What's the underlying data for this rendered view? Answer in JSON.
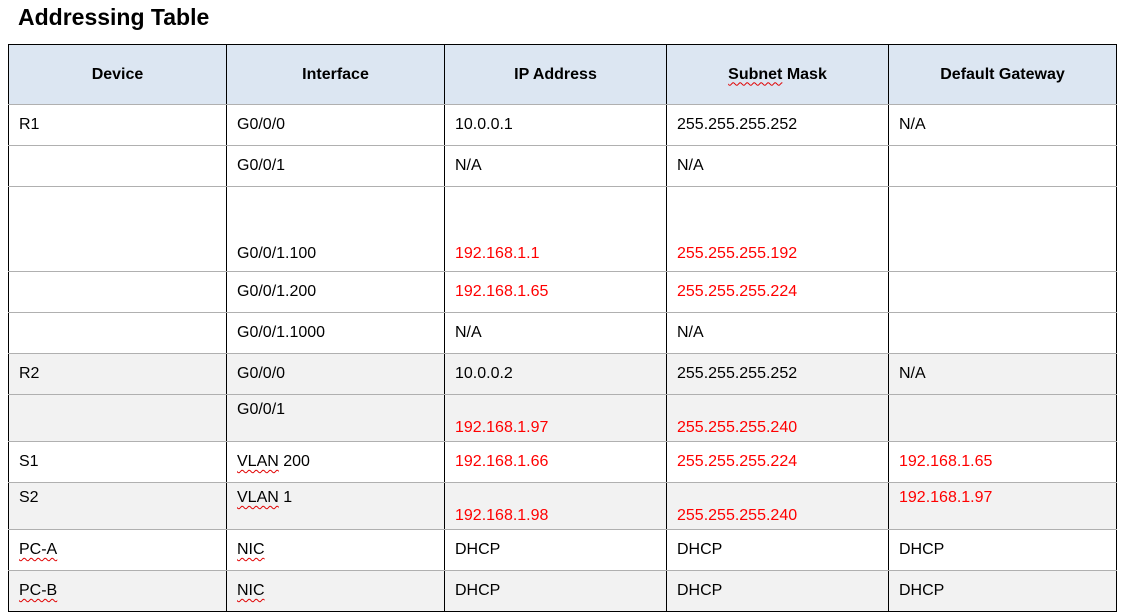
{
  "title": "Addressing Table",
  "headers": [
    "Device",
    "Interface",
    "IP Address",
    "Subnet Mask",
    "Default Gateway"
  ],
  "colors": {
    "header_bg": "#dce6f2",
    "shade_bg": "#f2f2f2",
    "red": "#ff0000",
    "border": "#000000"
  },
  "rows": [
    {
      "device": "R1",
      "interface": "G0/0/0",
      "ip": "10.0.0.1",
      "mask": "255.255.255.252",
      "gateway": "N/A"
    },
    {
      "device": "",
      "interface": "G0/0/1",
      "ip": "N/A",
      "mask": "N/A",
      "gateway": ""
    },
    {
      "device": "",
      "interface": "G0/0/1.100",
      "ip": "192.168.1.1",
      "mask": "255.255.255.192",
      "gateway": ""
    },
    {
      "device": "",
      "interface": "G0/0/1.200",
      "ip": "192.168.1.65",
      "mask": "255.255.255.224",
      "gateway": ""
    },
    {
      "device": "",
      "interface": "G0/0/1.1000",
      "ip": "N/A",
      "mask": "N/A",
      "gateway": ""
    },
    {
      "device": "R2",
      "interface": "G0/0/0",
      "ip": "10.0.0.2",
      "mask": "255.255.255.252",
      "gateway": "N/A"
    },
    {
      "device": "",
      "interface": "G0/0/1",
      "ip": "192.168.1.97",
      "mask": "255.255.255.240",
      "gateway": ""
    },
    {
      "device": "S1",
      "interface": "VLAN 200",
      "ip": "192.168.1.66",
      "mask": "255.255.255.224",
      "gateway": "192.168.1.65"
    },
    {
      "device": "S2",
      "interface": "VLAN 1",
      "ip": "192.168.1.98",
      "mask": "255.255.255.240",
      "gateway": "192.168.1.97"
    },
    {
      "device": "PC-A",
      "interface": "NIC",
      "ip": "DHCP",
      "mask": "DHCP",
      "gateway": "DHCP"
    },
    {
      "device": "PC-B",
      "interface": "NIC",
      "ip": "DHCP",
      "mask": "DHCP",
      "gateway": "DHCP"
    }
  ]
}
